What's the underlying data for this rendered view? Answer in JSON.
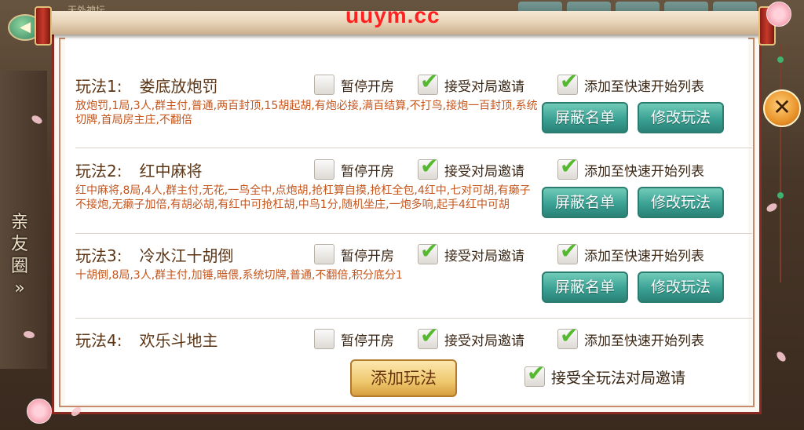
{
  "watermark": "uuym.cc",
  "background": {
    "top_text": "天外神坛",
    "side_label": [
      "亲",
      "友",
      "圈",
      "»"
    ]
  },
  "close": {
    "glyph": "✕"
  },
  "back": {
    "glyph": "◀"
  },
  "rules": [
    {
      "number": "玩法1:",
      "name": "娄底放炮罚",
      "description": "放炮罚,1局,3人,群主付,普通,两百封顶,15胡起胡,有炮必接,满百结算,不打鸟,接炮一百封顶,系统切牌,首局房主庄,不翻倍",
      "pause_label": "暂停开房",
      "pause_checked": false,
      "accept_label": "接受对局邀请",
      "accept_checked": true,
      "quick_label": "添加至快速开始列表",
      "quick_checked": true,
      "block_label": "屏蔽名单",
      "edit_label": "修改玩法"
    },
    {
      "number": "玩法2:",
      "name": "红中麻将",
      "description": "红中麻将,8局,4人,群主付,无花,一鸟全中,点炮胡,抢杠算自摸,抢杠全包,4红中,七对可胡,有癞子不接炮,无癞子加倍,有胡必胡,有红中可抢杠胡,中鸟1分,随机坐庄,一炮多响,起手4红中可胡",
      "pause_label": "暂停开房",
      "pause_checked": false,
      "accept_label": "接受对局邀请",
      "accept_checked": true,
      "quick_label": "添加至快速开始列表",
      "quick_checked": true,
      "block_label": "屏蔽名单",
      "edit_label": "修改玩法"
    },
    {
      "number": "玩法3:",
      "name": "冷水江十胡倒",
      "description": "十胡倒,8局,3人,群主付,加锤,暗偎,系统切牌,普通,不翻倍,积分底分1",
      "pause_label": "暂停开房",
      "pause_checked": false,
      "accept_label": "接受对局邀请",
      "accept_checked": true,
      "quick_label": "添加至快速开始列表",
      "quick_checked": true,
      "block_label": "屏蔽名单",
      "edit_label": "修改玩法"
    },
    {
      "number": "玩法4:",
      "name": "欢乐斗地主",
      "description": "",
      "pause_label": "暂停开房",
      "pause_checked": false,
      "accept_label": "接受对局邀请",
      "accept_checked": true,
      "quick_label": "添加至快速开始列表",
      "quick_checked": true
    }
  ],
  "footer": {
    "add_rule_label": "添加玩法",
    "accept_all_label": "接受全玩法对局邀请",
    "accept_all_checked": true
  },
  "colors": {
    "title": "#5b3515",
    "description": "#c4561e",
    "check": "#54b92f",
    "teal_button": "#3aa194",
    "gold_button": "#efc86e"
  }
}
